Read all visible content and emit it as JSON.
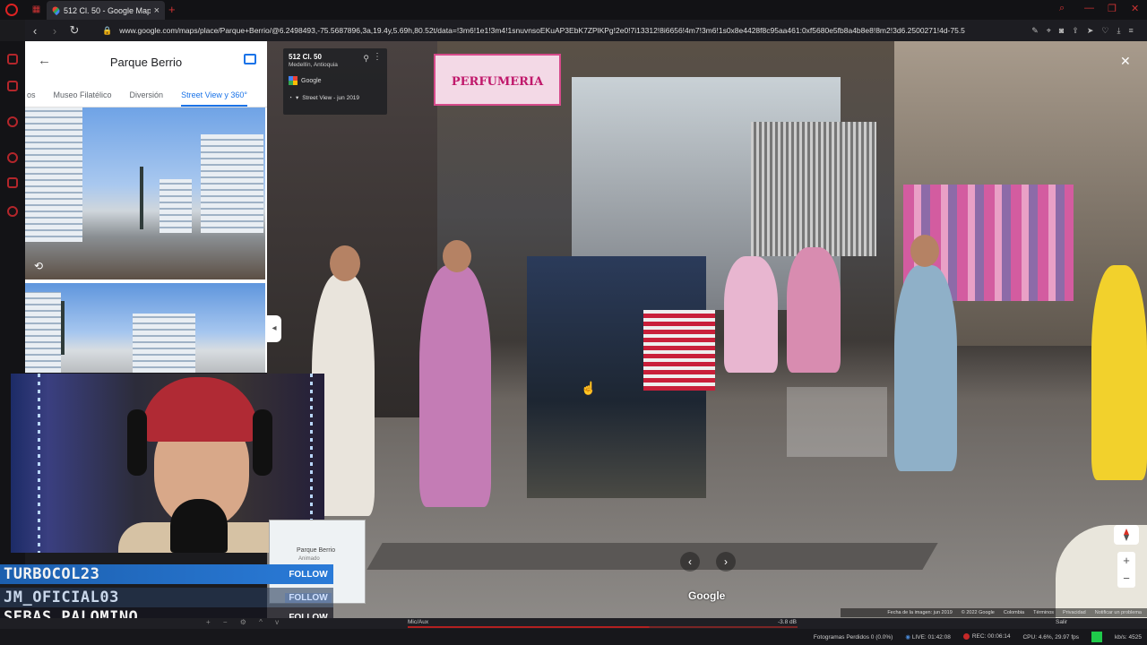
{
  "browser": {
    "tab_title": "512 Cl. 50 - Google Maps",
    "url": "www.google.com/maps/place/Parque+Berrio/@6.2498493,-75.5687896,3a,19.4y,5.69h,80.52t/data=!3m6!1e1!3m4!1snuvnsoEKuAP3EbK7ZPlKPg!2e0!7i13312!8i6656!4m7!3m6!1s0x8e4428f8c95aa461:0xf5680e5fb8a4b8e8!8m2!3d6.2500271!4d-75.5"
  },
  "place_panel": {
    "title": "Parque Berrio",
    "tabs": [
      "os",
      "Museo Filatélico",
      "Diversión",
      "Street View y 360°"
    ],
    "active_tab_index": 3
  },
  "street_view": {
    "address": "512 Cl. 50",
    "city": "Medellín, Antioquia",
    "source": "Google",
    "date_label": "Street View - jun 2019",
    "storefront_sign": "PERFUMERIA",
    "watermark": "Google",
    "footer": {
      "image_date": "Fecha de la imagen: jun 2019",
      "copyright": "© 2022 Google",
      "country": "Colombia",
      "terms": "Términos",
      "privacy": "Privacidad",
      "report": "Notificar un problema"
    }
  },
  "minimap": {
    "label": "Parque Berrio",
    "sublabel": "Animado"
  },
  "followers": [
    {
      "name": "TURBOCOL23",
      "tag": "FOLLOW"
    },
    {
      "name": "JM_OFICIAL03",
      "tag": "FOLLOW"
    },
    {
      "name": "SEBAS_PALOMINO",
      "tag": "FOLLOW"
    }
  ],
  "audio": {
    "label": "Mic/Aux",
    "db": "-3.8 dB",
    "exit": "Salir"
  },
  "status": {
    "frames_dropped": "Fotogramas Perdidos 0 (0.0%)",
    "live": "LIVE: 01:42:08",
    "rec": "REC: 00:06:14",
    "cpu": "CPU: 4.6%, 29.97 fps",
    "bitrate": "kb/s: 4525"
  },
  "colors": {
    "opera_red": "#c33333",
    "maps_blue": "#1a73e8",
    "follow_bar": "#2a7bd8",
    "obs_green": "#1fc94a"
  }
}
